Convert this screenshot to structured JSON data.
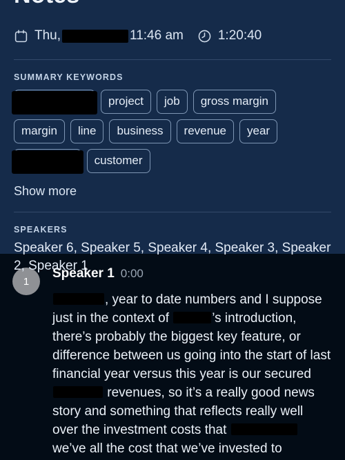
{
  "header": {
    "title": "Notes",
    "calendar_icon": "calendar-icon",
    "date_prefix": "Thu,",
    "date_redacted": "[redacted]",
    "time": "11:46 am",
    "clock_icon": "clock-icon",
    "duration": "1:20:40"
  },
  "keywords": {
    "label": "SUMMARY KEYWORDS",
    "chips": [
      {
        "label": "[redacted]",
        "redacted": true,
        "size": "wide"
      },
      {
        "label": "project",
        "redacted": false
      },
      {
        "label": "job",
        "redacted": false
      },
      {
        "label": "gross margin",
        "redacted": false
      },
      {
        "label": "margin",
        "redacted": false
      },
      {
        "label": "line",
        "redacted": false
      },
      {
        "label": "business",
        "redacted": false
      },
      {
        "label": "revenue",
        "redacted": false
      },
      {
        "label": "year",
        "redacted": false
      },
      {
        "label": "[redacted]",
        "redacted": true,
        "size": "narrow"
      },
      {
        "label": "customer",
        "redacted": false
      }
    ],
    "show_more_label": "Show more"
  },
  "speakers": {
    "label": "SPEAKERS",
    "list": "Speaker 6, Speaker 5, Speaker 4, Speaker 3, Speaker 2, Speaker 1"
  },
  "transcript": {
    "entry": {
      "avatar_initial": "1",
      "speaker": "Speaker 1",
      "timestamp": "0:00",
      "text_part_1": ", year to date numbers and I suppose just in the context of ",
      "text_part_2": "’s introduction, there’s probably the biggest key feature, or difference between us going into the start of last financial year versus this year is our secured ",
      "text_part_3": " revenues, so it’s a really good news story and something that reflects really well over the investment costs that ",
      "text_part_4": " we’ve all the cost that we’ve invested to"
    }
  },
  "colors": {
    "panel_background": "#152b4a",
    "transcript_background": "#030c16",
    "chip_border": "#7e96b4",
    "avatar_background": "#8f9195",
    "redaction": "#000000"
  }
}
